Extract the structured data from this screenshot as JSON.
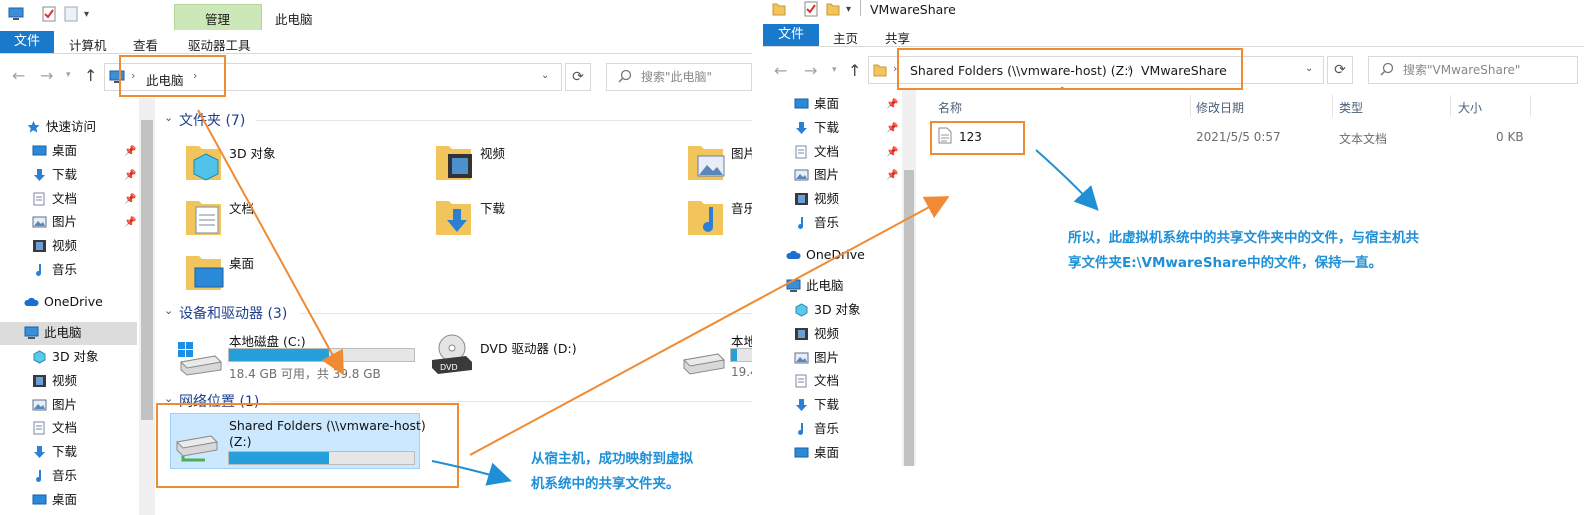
{
  "left": {
    "tab_group_label": "管理",
    "window_title": "此电脑",
    "menu": {
      "file": "文件",
      "tab1": "计算机",
      "tab2": "查看",
      "tab3": "驱动器工具"
    },
    "address": {
      "crumb": "此电脑"
    },
    "search_placeholder": "搜索\"此电脑\"",
    "sidebar": {
      "quick_access": "快速访问",
      "items_quick": [
        "桌面",
        "下载",
        "文档",
        "图片",
        "视频",
        "音乐"
      ],
      "onedrive": "OneDrive",
      "this_pc": "此电脑",
      "items_pc": [
        "3D 对象",
        "视频",
        "图片",
        "文档",
        "下载",
        "音乐",
        "桌面"
      ]
    },
    "groups": {
      "folders_header": "文件夹 (7)",
      "folders": [
        "3D 对象",
        "视频",
        "图片",
        "文档",
        "下载",
        "音乐",
        "桌面"
      ],
      "devices_header": "设备和驱动器 (3)",
      "drive_c": {
        "name": "本地磁盘 (C:)",
        "free": "18.4 GB 可用，共 39.8 GB",
        "used_fraction": 0.54
      },
      "drive_d": {
        "name": "DVD 驱动器 (D:)"
      },
      "drive_e": {
        "name": "本地",
        "free": "19.4",
        "used_fraction": 0.3
      },
      "network_header": "网络位置 (1)",
      "network": {
        "name_line1": "Shared Folders (\\\\vmware-host)",
        "name_line2": "(Z:)",
        "used_fraction": 0.54
      }
    }
  },
  "right": {
    "window_title": "VMwareShare",
    "menu": {
      "file": "文件",
      "tab1": "主页",
      "tab2": "共享"
    },
    "address": {
      "crumb1": "Shared Folders (\\\\vmware-host) (Z:)",
      "crumb2": "VMwareShare"
    },
    "search_placeholder": "搜索\"VMwareShare\"",
    "sidebar": {
      "items_quick": [
        "桌面",
        "下载",
        "文档",
        "图片",
        "视频",
        "音乐"
      ],
      "onedrive": "OneDrive",
      "this_pc": "此电脑",
      "items_pc": [
        "3D 对象",
        "视频",
        "图片",
        "文档",
        "下载",
        "音乐",
        "桌面"
      ]
    },
    "columns": {
      "name": "名称",
      "date": "修改日期",
      "type": "类型",
      "size": "大小"
    },
    "files": [
      {
        "name": "123",
        "date": "2021/5/5 0:57",
        "type": "文本文档",
        "size": "0 KB"
      }
    ]
  },
  "annotations": {
    "note1_line1": "从宿主机，成功映射到虚拟",
    "note1_line2": "机系统中的共享文件夹。",
    "note2_line1": "所以，此虚拟机系统中的共享文件夹中的文件，与宿主机共",
    "note2_line2": "享文件夹E:\\VMwareShare中的文件，保持一直。"
  },
  "colors": {
    "accent": "#1979ca",
    "annotation_box": "#f08a33",
    "annotation_text": "#1f8fd6",
    "progress": "#26a0da",
    "tab_highlight": "#cde8b8"
  }
}
